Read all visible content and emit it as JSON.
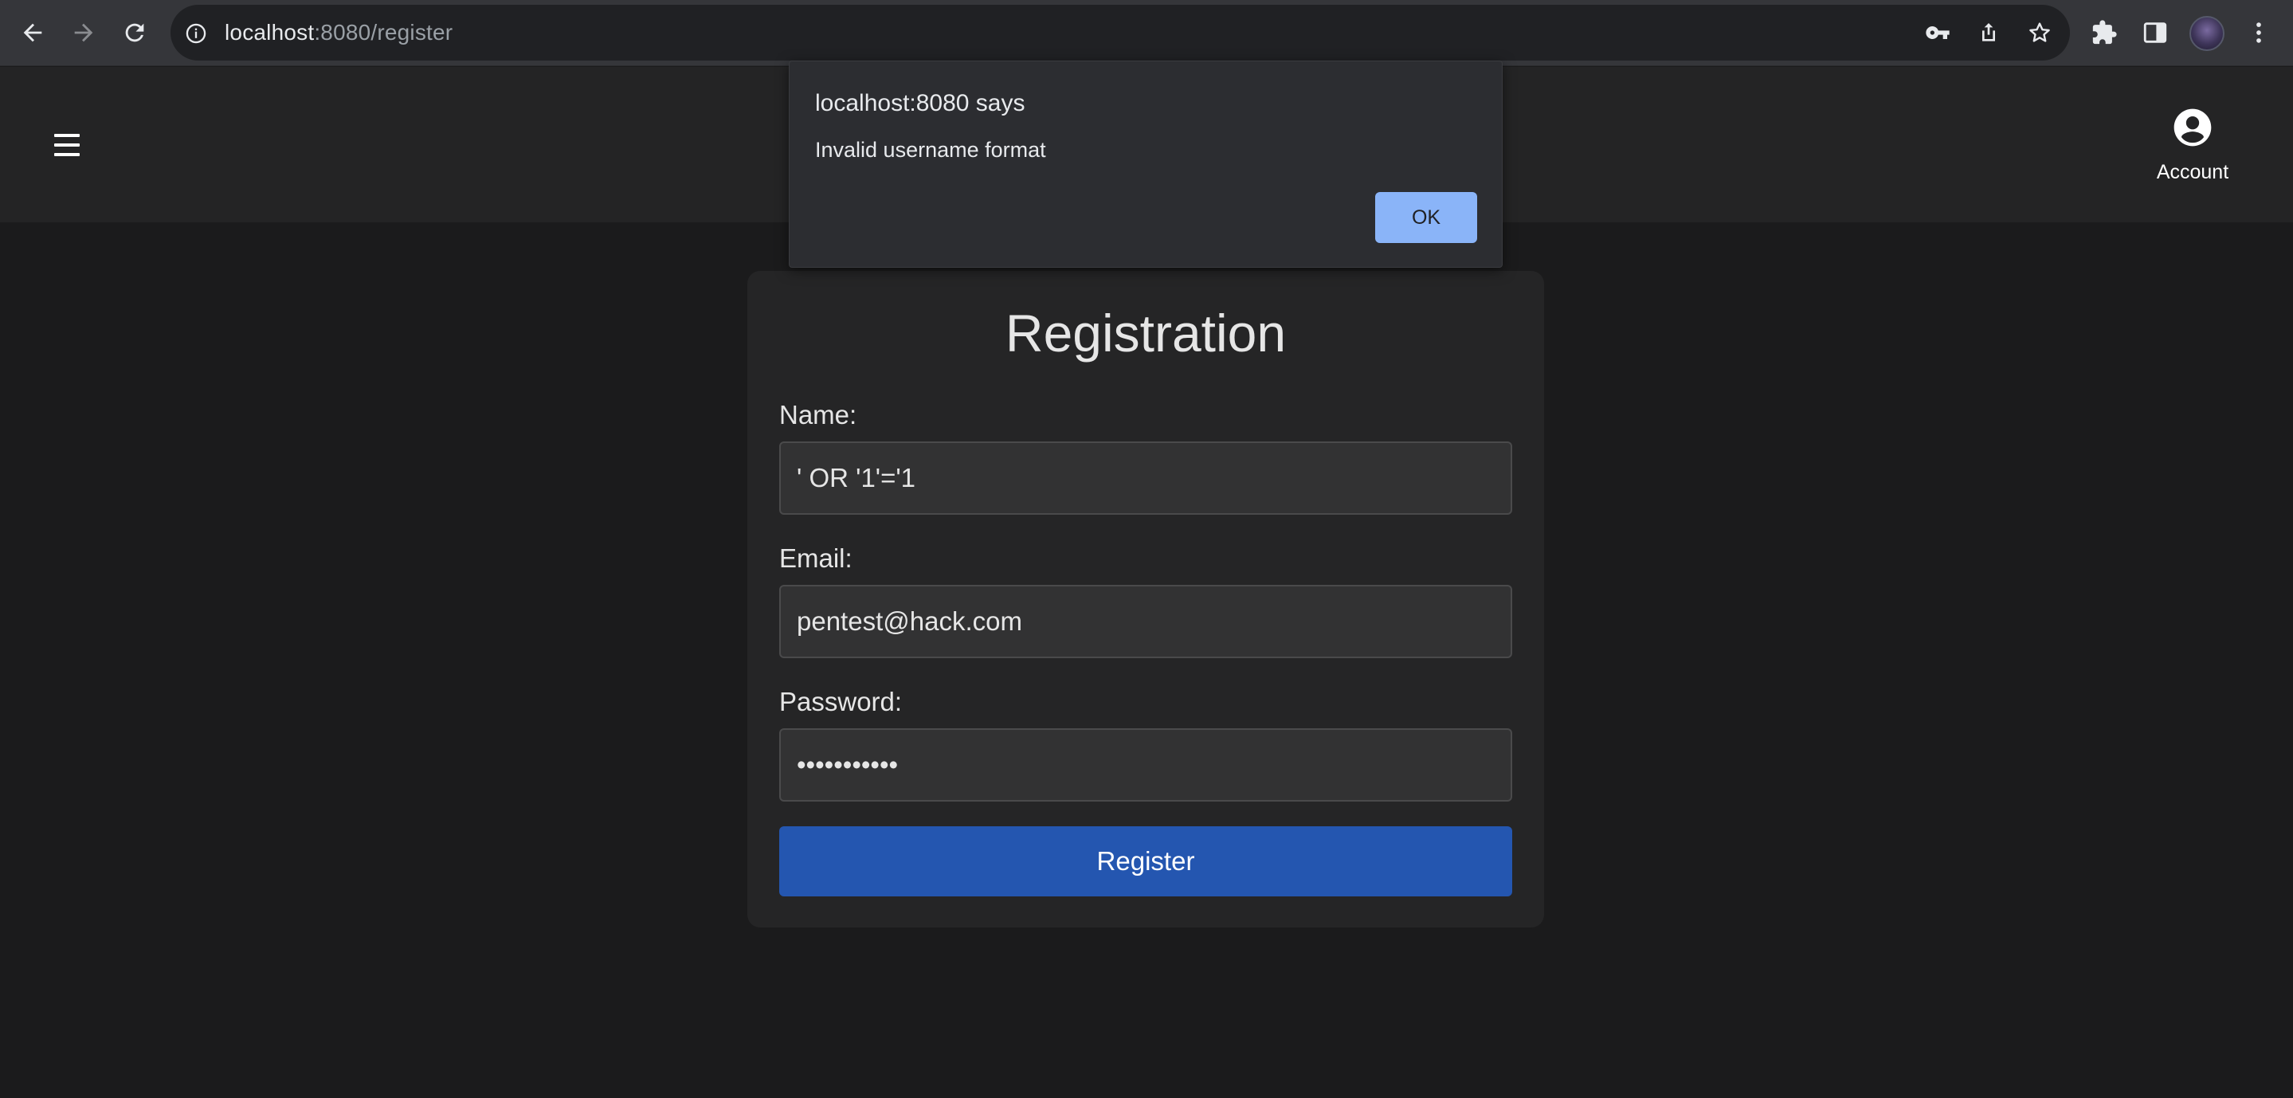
{
  "browser": {
    "url_host": "localhost",
    "url_path": ":8080/register",
    "icons": {
      "back": "back-arrow-icon",
      "forward": "forward-arrow-icon",
      "reload": "reload-icon",
      "site_info": "info-icon",
      "password_key": "key-icon",
      "share": "share-icon",
      "bookmark": "star-icon",
      "extensions": "puzzle-icon",
      "side_panel": "side-panel-icon",
      "menu": "kebab-menu-icon"
    }
  },
  "header": {
    "menu_icon": "hamburger-icon",
    "account_label": "Account",
    "account_icon": "account-circle-icon"
  },
  "form": {
    "title": "Registration",
    "name_label": "Name:",
    "name_value": "' OR '1'='1",
    "email_label": "Email:",
    "email_value": "pentest@hack.com",
    "password_label": "Password:",
    "password_value": "•••••••••••",
    "submit_label": "Register"
  },
  "alert": {
    "title": "localhost:8080 says",
    "message": "Invalid username format",
    "ok_label": "OK"
  },
  "colors": {
    "page_bg": "#1b1b1c",
    "header_bg": "#242425",
    "card_bg": "#252526",
    "button_blue": "#2456b0",
    "alert_ok_bg": "#8ab4f8"
  }
}
